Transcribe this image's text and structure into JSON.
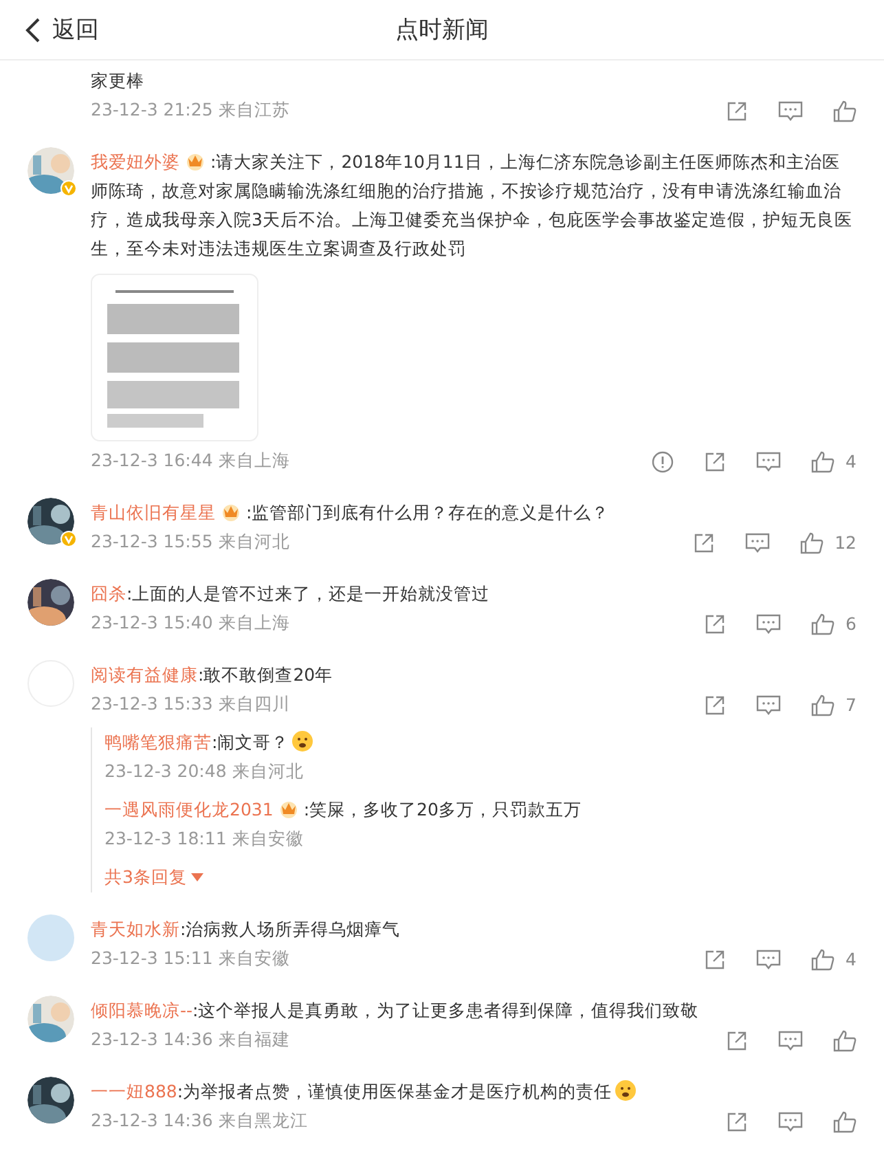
{
  "top_bar": {
    "back_label": "返回",
    "title": "点时新闻"
  },
  "comments": [
    {
      "kind": "continuation",
      "text": "家更棒",
      "time": "23-12-3 21:25 来自江苏",
      "report": false
    },
    {
      "kind": "comment",
      "verified": true,
      "vip": true,
      "user": "我爱妞外婆",
      "text": ":请大家关注下，2018年10月11日，上海仁济东院急诊副主任医师陈杰和主治医师陈琦，故意对家属隐瞒输洗涤红细胞的治疗措施，不按诊疗规范治疗，没有申请洗涤红输血治疗，造成我母亲入院3天后不治。上海卫健委充当保护伞，包庇医学会事故鉴定造假，护短无良医生，至今未对违法违规医生立案调查及行政处罚",
      "time": "23-12-3 16:44 来自上海",
      "report": true,
      "likes": "4"
    },
    {
      "kind": "comment",
      "verified": true,
      "vip": true,
      "user": "青山依旧有星星",
      "text": ":监管部门到底有什么用？存在的意义是什么？",
      "time": "23-12-3 15:55 来自河北",
      "report": false,
      "likes": "12"
    },
    {
      "kind": "comment",
      "verified": false,
      "vip": false,
      "user": "囧杀",
      "text": ":上面的人是管不过来了，还是一开始就没管过",
      "time": "23-12-3 15:40 来自上海",
      "report": false,
      "likes": "6"
    },
    {
      "kind": "comment",
      "avatar": {
        "kind": "blank"
      },
      "verified": false,
      "vip": false,
      "user": "阅读有益健康",
      "text": ":敢不敢倒查20年",
      "time": "23-12-3 15:33 来自四川",
      "report": false,
      "likes": "7",
      "replies": [
        {
          "user": "鸭嘴笔狠痛苦",
          "vip": false,
          "text": ":闹文哥？",
          "emoji": true,
          "time": "23-12-3 20:48 来自河北"
        },
        {
          "user": "一遇风雨便化龙2031",
          "vip": true,
          "text": ":笑屎，多收了20多万，只罚款五万",
          "emoji": false,
          "time": "23-12-3 18:11 来自安徽"
        }
      ],
      "more_replies": "共3条回复"
    },
    {
      "kind": "comment",
      "avatar": {
        "kind": "plain"
      },
      "verified": false,
      "vip": false,
      "user": "青天如水新",
      "text": ":治病救人场所弄得乌烟瘴气",
      "time": "23-12-3 15:11 来自安徽",
      "report": false,
      "likes": "4"
    },
    {
      "kind": "comment",
      "verified": false,
      "vip": false,
      "user": "倾阳慕晚凉--",
      "text": ":这个举报人是真勇敢，为了让更多患者得到保障，值得我们致敬",
      "time": "23-12-3 14:36 来自福建",
      "report": false
    },
    {
      "kind": "comment",
      "verified": false,
      "vip": false,
      "user": "一一妞888",
      "text": ":为举报者点赞，谨慎使用医保基金才是医疗机构的责任",
      "emoji": true,
      "time": "23-12-3 14:36 来自黑龙江",
      "report": false
    }
  ]
}
